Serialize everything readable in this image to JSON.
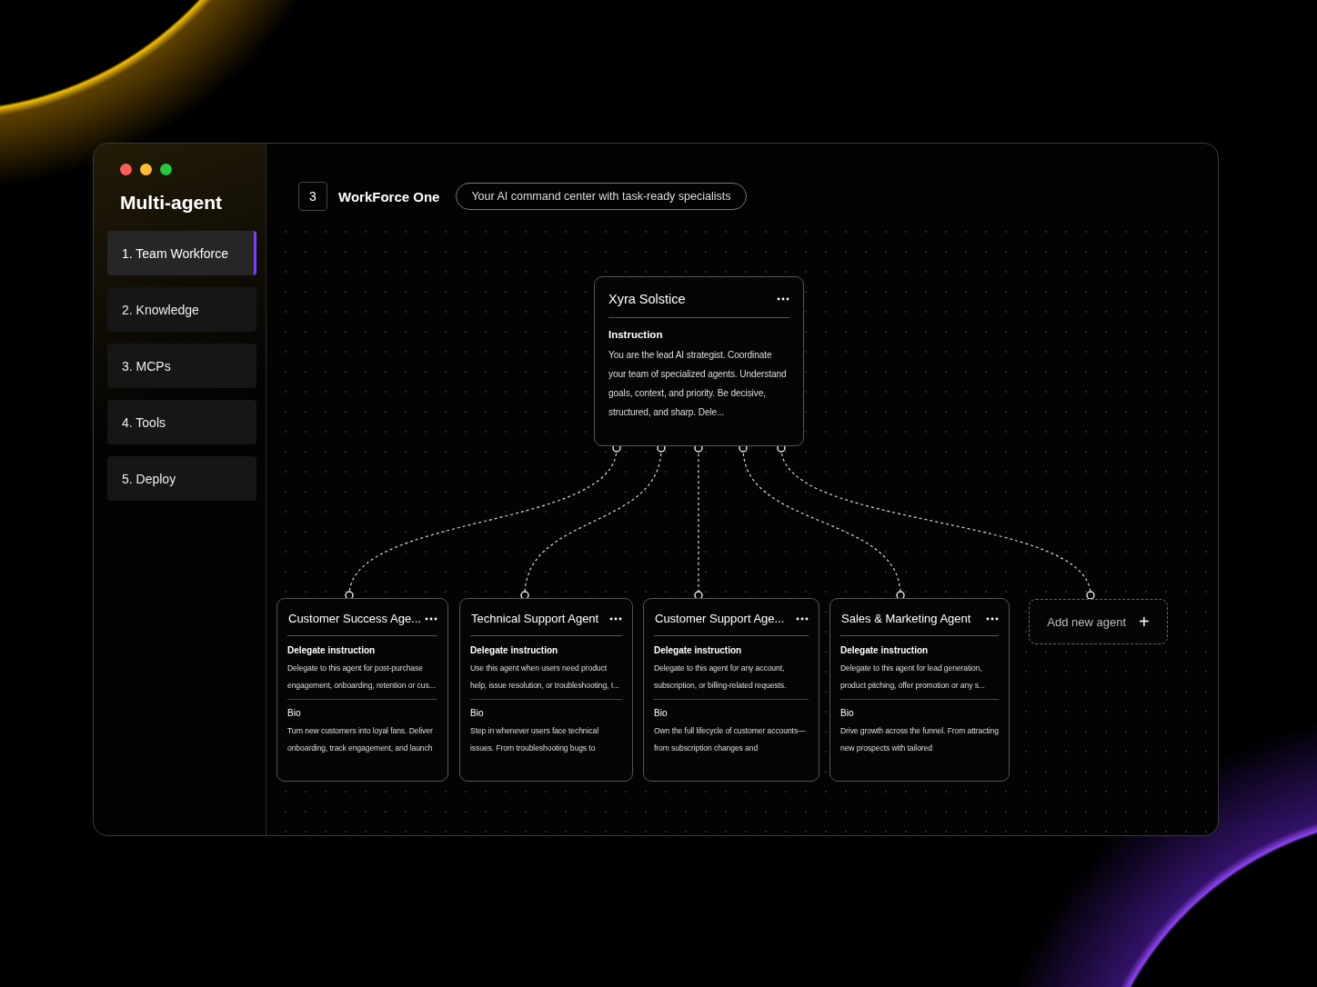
{
  "app_title": "Multi-agent",
  "nav": [
    {
      "label": "1. Team Workforce",
      "selected": true
    },
    {
      "label": "2. Knowledge",
      "selected": false
    },
    {
      "label": "3. MCPs",
      "selected": false
    },
    {
      "label": "4. Tools",
      "selected": false
    },
    {
      "label": "5. Deploy",
      "selected": false
    }
  ],
  "header": {
    "count": "3",
    "title": "WorkForce One",
    "subtitle": "Your AI command center with task-ready specialists"
  },
  "lead_agent": {
    "name": "Xyra Solstice",
    "section": "Instruction",
    "text": "You are the lead AI strategist. Coordinate your team of specialized agents. Understand goals, context, and priority. Be decisive, structured, and sharp. Dele..."
  },
  "agents": [
    {
      "name": "Customer Success Age...",
      "instruction_label": "Delegate instruction",
      "instruction": "Delegate to this agent for post-purchase engagement, onboarding, retention or cus...",
      "bio_label": "Bio",
      "bio": "Turn new customers into loyal fans. Deliver onboarding, track engagement, and launch"
    },
    {
      "name": "Technical Support Agent",
      "instruction_label": "Delegate instruction",
      "instruction": "Use this agent when users need product help, issue resolution, or troubleshooting, I...",
      "bio_label": "Bio",
      "bio": "Step in whenever users face technical issues. From troubleshooting bugs to"
    },
    {
      "name": "Customer Support Age...",
      "instruction_label": "Delegate instruction",
      "instruction": "Delegate to this agent for any account, subscription, or billing-related requests.",
      "bio_label": "Bio",
      "bio": "Own the full lifecycle of customer accounts—from subscription changes and"
    },
    {
      "name": "Sales & Marketing Agent",
      "instruction_label": "Delegate instruction",
      "instruction": "Delegate to this agent for lead generation, product pitching, offer promotion or any s...",
      "bio_label": "Bio",
      "bio": "Drive growth across the funnel. From attracting new prospects with tailored"
    }
  ],
  "add_agent": {
    "label": "Add new agent",
    "icon": "+"
  }
}
